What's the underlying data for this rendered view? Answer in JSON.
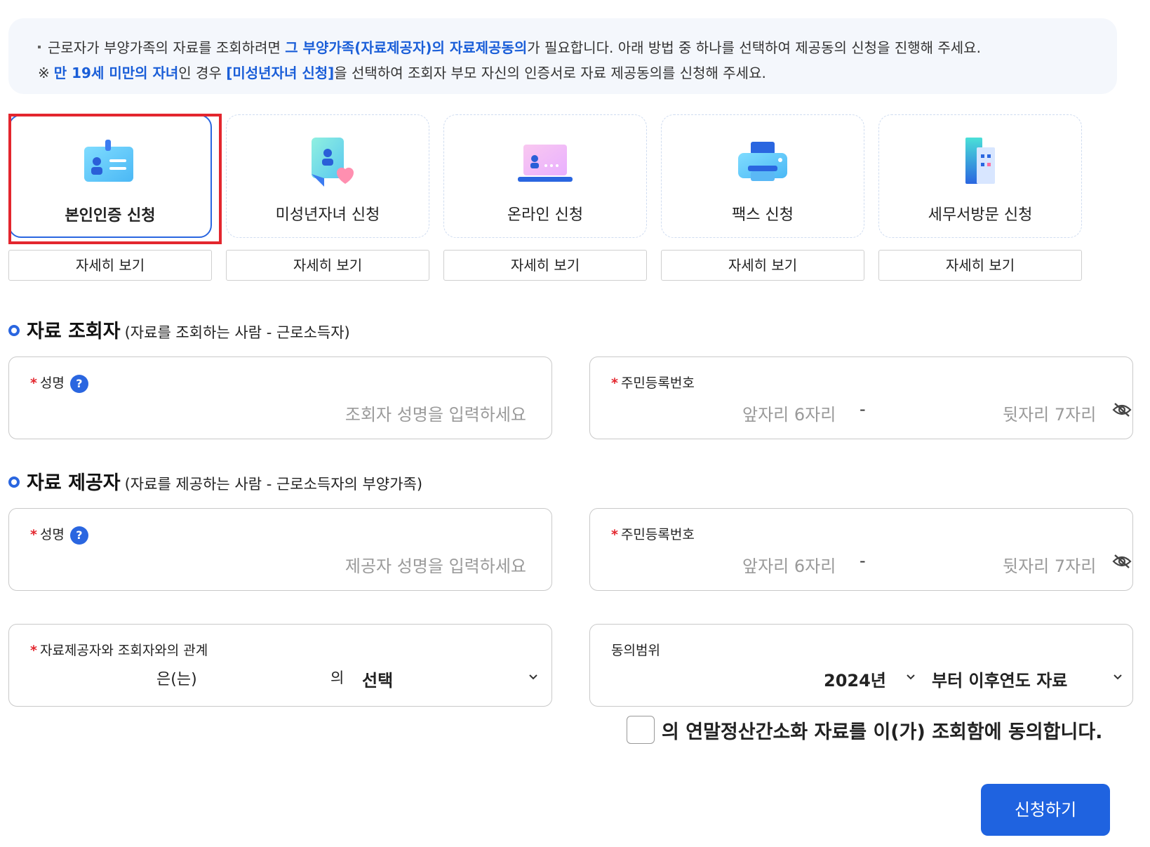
{
  "notice": {
    "line1_pre": "근로자가 부양가족의 자료를 조회하려면",
    "line1_link": "그 부양가족(자료제공자)의 자료제공동의",
    "line1_post": "가 필요합니다. 아래 방법 중 하나를 선택하여 제공동의 신청을 진행해 주세요.",
    "line2_mark": "※",
    "line2_blue1": "만 19세 미만의 자녀",
    "line2_mid": "인 경우",
    "line2_blue2": "[미성년자녀 신청]",
    "line2_post": "을 선택하여 조회자 부모 자신의 인증서로 자료 제공동의를 신청해 주세요."
  },
  "cards": [
    {
      "label": "본인인증 신청",
      "icon": "id-card-icon",
      "selected": true,
      "detail": "자세히 보기"
    },
    {
      "label": "미성년자녀 신청",
      "icon": "child-heart-icon",
      "selected": false,
      "detail": "자세히 보기"
    },
    {
      "label": "온라인 신청",
      "icon": "laptop-icon",
      "selected": false,
      "detail": "자세히 보기"
    },
    {
      "label": "팩스 신청",
      "icon": "fax-printer-icon",
      "selected": false,
      "detail": "자세히 보기"
    },
    {
      "label": "세무서방문 신청",
      "icon": "building-icon",
      "selected": false,
      "detail": "자세히 보기"
    }
  ],
  "viewer_section": {
    "title": "자료 조회자",
    "subtitle": "(자료를 조회하는 사람 - 근로소득자)",
    "name_label": "성명",
    "name_placeholder": "조회자 성명을 입력하세요",
    "rrn_label": "주민등록번호",
    "rrn_front_placeholder": "앞자리 6자리",
    "rrn_dash": "-",
    "rrn_back_placeholder": "뒷자리 7자리"
  },
  "provider_section": {
    "title": "자료 제공자",
    "subtitle": "(자료를 제공하는 사람 - 근로소득자의 부양가족)",
    "name_label": "성명",
    "name_placeholder": "제공자 성명을 입력하세요",
    "rrn_label": "주민등록번호",
    "rrn_front_placeholder": "앞자리 6자리",
    "rrn_dash": "-",
    "rrn_back_placeholder": "뒷자리 7자리"
  },
  "relation": {
    "label": "자료제공자와 조회자와의 관계",
    "suffix1": "은(는)",
    "suffix2": "의",
    "selected": "선택"
  },
  "consent_scope": {
    "label": "동의범위",
    "year": "2024년",
    "range": "부터 이후연도 자료"
  },
  "agree_text": "의 연말정산간소화 자료를 이(가) 조회함에 동의합니다.",
  "submit_label": "신청하기",
  "required_mark": "*",
  "help_mark": "?",
  "colors": {
    "accent": "#1f63e0",
    "highlight": "#e3262e",
    "required": "#e3262e"
  }
}
